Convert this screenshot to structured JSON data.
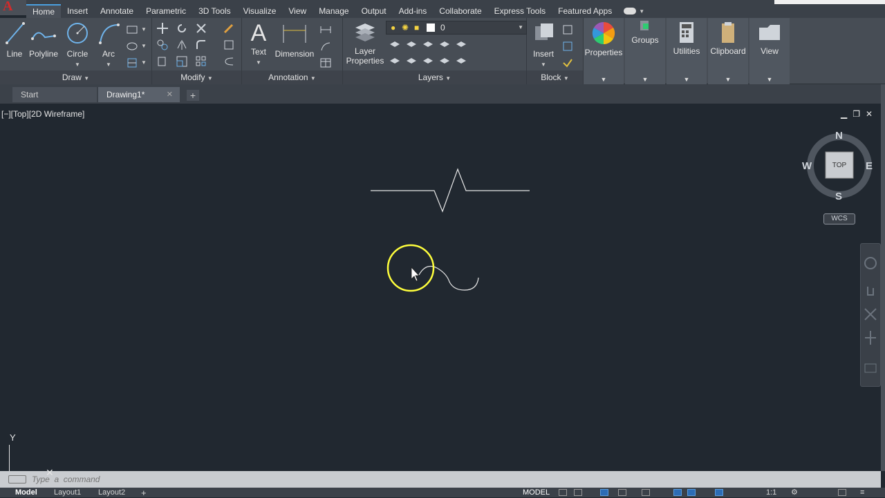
{
  "app": {
    "logo_letter": "A"
  },
  "ribbon_tabs": [
    {
      "label": "Home",
      "active": true
    },
    {
      "label": "Insert"
    },
    {
      "label": "Annotate"
    },
    {
      "label": "Parametric"
    },
    {
      "label": "3D Tools"
    },
    {
      "label": "Visualize"
    },
    {
      "label": "View"
    },
    {
      "label": "Manage"
    },
    {
      "label": "Output"
    },
    {
      "label": "Add-ins"
    },
    {
      "label": "Collaborate"
    },
    {
      "label": "Express Tools"
    },
    {
      "label": "Featured Apps"
    }
  ],
  "panels": {
    "draw": {
      "title": "Draw",
      "line": "Line",
      "polyline": "Polyline",
      "circle": "Circle",
      "arc": "Arc"
    },
    "modify": {
      "title": "Modify"
    },
    "annotation": {
      "title": "Annotation",
      "text": "Text",
      "dimension": "Dimension"
    },
    "layers": {
      "title": "Layers",
      "layer_properties_1": "Layer",
      "layer_properties_2": "Properties",
      "current_layer": "0"
    },
    "block": {
      "title": "Block",
      "insert": "Insert"
    },
    "properties": "Properties",
    "groups": "Groups",
    "utilities": "Utilities",
    "clipboard": "Clipboard",
    "view": "View"
  },
  "doc_tabs": [
    {
      "label": "Start"
    },
    {
      "label": "Drawing1*",
      "active": true
    }
  ],
  "viewport": {
    "label": "[−][Top][2D Wireframe]",
    "compass": {
      "n": "N",
      "s": "S",
      "e": "E",
      "w": "W",
      "cube_face": "TOP"
    },
    "wcs": "WCS",
    "ucs_y": "Y"
  },
  "command_line": {
    "placeholder": "Type  a  command"
  },
  "status_bar": {
    "tabs": [
      "Model",
      "Layout1",
      "Layout2"
    ],
    "model_label": "MODEL",
    "scale": "1:1"
  },
  "colors": {
    "canvas": "#212830",
    "ribbon": "#474d55",
    "accent": "#4a9fe0",
    "cursor_highlight": "#ffff3c",
    "logo": "#d42a2a"
  }
}
